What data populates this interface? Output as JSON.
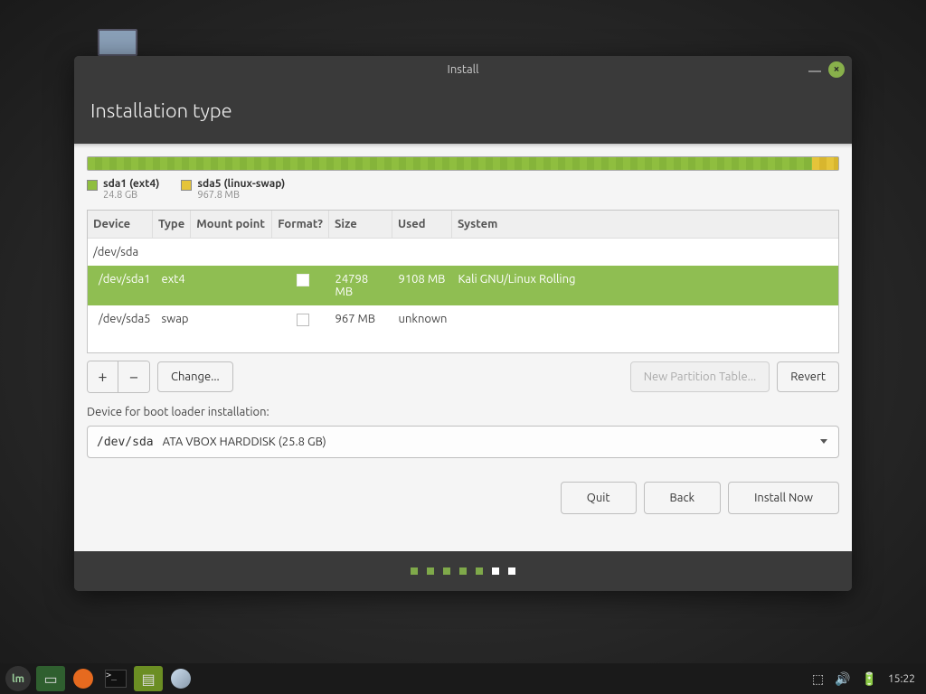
{
  "window": {
    "title": "Install",
    "heading": "Installation type"
  },
  "legend": [
    {
      "name": "sda1 (ext4)",
      "size": "24.8 GB"
    },
    {
      "name": "sda5 (linux-swap)",
      "size": "967.8 MB"
    }
  ],
  "table": {
    "headers": {
      "device": "Device",
      "type": "Type",
      "mount": "Mount point",
      "format": "Format?",
      "size": "Size",
      "used": "Used",
      "system": "System"
    },
    "rows": [
      {
        "device": "/dev/sda",
        "type": "",
        "mount": "",
        "format": "",
        "size": "",
        "used": "",
        "system": "",
        "selected": false,
        "indent": false
      },
      {
        "device": "/dev/sda1",
        "type": "ext4",
        "mount": "",
        "format": "checkbox",
        "size": "24798 MB",
        "used": "9108 MB",
        "system": "Kali GNU/Linux Rolling",
        "selected": true,
        "indent": true
      },
      {
        "device": "/dev/sda5",
        "type": "swap",
        "mount": "",
        "format": "checkbox",
        "size": "967 MB",
        "used": "unknown",
        "system": "",
        "selected": false,
        "indent": true
      }
    ]
  },
  "toolbar": {
    "add": "+",
    "remove": "−",
    "change": "Change...",
    "new_partition_table": "New Partition Table...",
    "revert": "Revert"
  },
  "bootloader": {
    "label": "Device for boot loader installation:",
    "device": "/dev/sda",
    "desc": "ATA VBOX HARDDISK (25.8 GB)"
  },
  "nav": {
    "quit": "Quit",
    "back": "Back",
    "install": "Install Now"
  },
  "progress": {
    "total": 7,
    "done": 5
  },
  "taskbar": {
    "clock": "15:22"
  }
}
